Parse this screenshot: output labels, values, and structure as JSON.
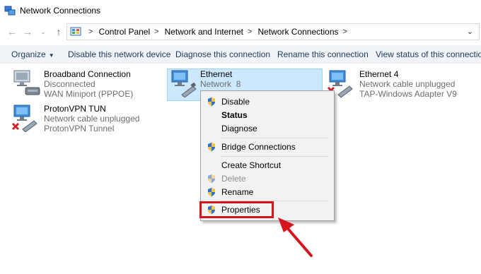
{
  "window": {
    "title": "Network Connections"
  },
  "breadcrumb": [
    "Control Panel",
    "Network and Internet",
    "Network Connections"
  ],
  "toolbar": {
    "organize": "Organize",
    "disable": "Disable this network device",
    "diagnose": "Diagnose this connection",
    "rename": "Rename this connection",
    "view_status": "View status of this connection"
  },
  "connections": [
    {
      "name": "Broadband Connection",
      "line1": "Disconnected",
      "line2": "WAN Miniport (PPPOE)"
    },
    {
      "name": "Ethernet",
      "line1": "Network",
      "line1b": "8",
      "line2": ""
    },
    {
      "name": "Ethernet 4",
      "line1": "Network cable unplugged",
      "line2": "TAP-Windows Adapter V9"
    },
    {
      "name": "ProtonVPN TUN",
      "line1": "Network cable unplugged",
      "line2": "ProtonVPN Tunnel"
    }
  ],
  "context_menu": {
    "disable": "Disable",
    "status": "Status",
    "diagnose": "Diagnose",
    "bridge": "Bridge Connections",
    "shortcut": "Create Shortcut",
    "delete": "Delete",
    "rename": "Rename",
    "properties": "Properties"
  },
  "colors": {
    "highlight": "#d6141b",
    "selection": "#cce8ff",
    "command_bar": "#f0f4f9"
  }
}
